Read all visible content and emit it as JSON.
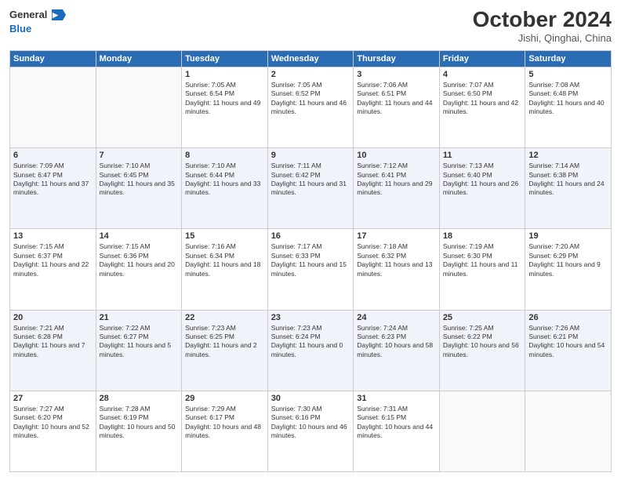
{
  "header": {
    "logo_line1": "General",
    "logo_line2": "Blue",
    "month": "October 2024",
    "location": "Jishi, Qinghai, China"
  },
  "days_of_week": [
    "Sunday",
    "Monday",
    "Tuesday",
    "Wednesday",
    "Thursday",
    "Friday",
    "Saturday"
  ],
  "weeks": [
    [
      {
        "day": "",
        "empty": true
      },
      {
        "day": "",
        "empty": true
      },
      {
        "day": "1",
        "sunrise": "Sunrise: 7:05 AM",
        "sunset": "Sunset: 6:54 PM",
        "daylight": "Daylight: 11 hours and 49 minutes."
      },
      {
        "day": "2",
        "sunrise": "Sunrise: 7:05 AM",
        "sunset": "Sunset: 6:52 PM",
        "daylight": "Daylight: 11 hours and 46 minutes."
      },
      {
        "day": "3",
        "sunrise": "Sunrise: 7:06 AM",
        "sunset": "Sunset: 6:51 PM",
        "daylight": "Daylight: 11 hours and 44 minutes."
      },
      {
        "day": "4",
        "sunrise": "Sunrise: 7:07 AM",
        "sunset": "Sunset: 6:50 PM",
        "daylight": "Daylight: 11 hours and 42 minutes."
      },
      {
        "day": "5",
        "sunrise": "Sunrise: 7:08 AM",
        "sunset": "Sunset: 6:48 PM",
        "daylight": "Daylight: 11 hours and 40 minutes."
      }
    ],
    [
      {
        "day": "6",
        "sunrise": "Sunrise: 7:09 AM",
        "sunset": "Sunset: 6:47 PM",
        "daylight": "Daylight: 11 hours and 37 minutes."
      },
      {
        "day": "7",
        "sunrise": "Sunrise: 7:10 AM",
        "sunset": "Sunset: 6:45 PM",
        "daylight": "Daylight: 11 hours and 35 minutes."
      },
      {
        "day": "8",
        "sunrise": "Sunrise: 7:10 AM",
        "sunset": "Sunset: 6:44 PM",
        "daylight": "Daylight: 11 hours and 33 minutes."
      },
      {
        "day": "9",
        "sunrise": "Sunrise: 7:11 AM",
        "sunset": "Sunset: 6:42 PM",
        "daylight": "Daylight: 11 hours and 31 minutes."
      },
      {
        "day": "10",
        "sunrise": "Sunrise: 7:12 AM",
        "sunset": "Sunset: 6:41 PM",
        "daylight": "Daylight: 11 hours and 29 minutes."
      },
      {
        "day": "11",
        "sunrise": "Sunrise: 7:13 AM",
        "sunset": "Sunset: 6:40 PM",
        "daylight": "Daylight: 11 hours and 26 minutes."
      },
      {
        "day": "12",
        "sunrise": "Sunrise: 7:14 AM",
        "sunset": "Sunset: 6:38 PM",
        "daylight": "Daylight: 11 hours and 24 minutes."
      }
    ],
    [
      {
        "day": "13",
        "sunrise": "Sunrise: 7:15 AM",
        "sunset": "Sunset: 6:37 PM",
        "daylight": "Daylight: 11 hours and 22 minutes."
      },
      {
        "day": "14",
        "sunrise": "Sunrise: 7:15 AM",
        "sunset": "Sunset: 6:36 PM",
        "daylight": "Daylight: 11 hours and 20 minutes."
      },
      {
        "day": "15",
        "sunrise": "Sunrise: 7:16 AM",
        "sunset": "Sunset: 6:34 PM",
        "daylight": "Daylight: 11 hours and 18 minutes."
      },
      {
        "day": "16",
        "sunrise": "Sunrise: 7:17 AM",
        "sunset": "Sunset: 6:33 PM",
        "daylight": "Daylight: 11 hours and 15 minutes."
      },
      {
        "day": "17",
        "sunrise": "Sunrise: 7:18 AM",
        "sunset": "Sunset: 6:32 PM",
        "daylight": "Daylight: 11 hours and 13 minutes."
      },
      {
        "day": "18",
        "sunrise": "Sunrise: 7:19 AM",
        "sunset": "Sunset: 6:30 PM",
        "daylight": "Daylight: 11 hours and 11 minutes."
      },
      {
        "day": "19",
        "sunrise": "Sunrise: 7:20 AM",
        "sunset": "Sunset: 6:29 PM",
        "daylight": "Daylight: 11 hours and 9 minutes."
      }
    ],
    [
      {
        "day": "20",
        "sunrise": "Sunrise: 7:21 AM",
        "sunset": "Sunset: 6:28 PM",
        "daylight": "Daylight: 11 hours and 7 minutes."
      },
      {
        "day": "21",
        "sunrise": "Sunrise: 7:22 AM",
        "sunset": "Sunset: 6:27 PM",
        "daylight": "Daylight: 11 hours and 5 minutes."
      },
      {
        "day": "22",
        "sunrise": "Sunrise: 7:23 AM",
        "sunset": "Sunset: 6:25 PM",
        "daylight": "Daylight: 11 hours and 2 minutes."
      },
      {
        "day": "23",
        "sunrise": "Sunrise: 7:23 AM",
        "sunset": "Sunset: 6:24 PM",
        "daylight": "Daylight: 11 hours and 0 minutes."
      },
      {
        "day": "24",
        "sunrise": "Sunrise: 7:24 AM",
        "sunset": "Sunset: 6:23 PM",
        "daylight": "Daylight: 10 hours and 58 minutes."
      },
      {
        "day": "25",
        "sunrise": "Sunrise: 7:25 AM",
        "sunset": "Sunset: 6:22 PM",
        "daylight": "Daylight: 10 hours and 56 minutes."
      },
      {
        "day": "26",
        "sunrise": "Sunrise: 7:26 AM",
        "sunset": "Sunset: 6:21 PM",
        "daylight": "Daylight: 10 hours and 54 minutes."
      }
    ],
    [
      {
        "day": "27",
        "sunrise": "Sunrise: 7:27 AM",
        "sunset": "Sunset: 6:20 PM",
        "daylight": "Daylight: 10 hours and 52 minutes."
      },
      {
        "day": "28",
        "sunrise": "Sunrise: 7:28 AM",
        "sunset": "Sunset: 6:19 PM",
        "daylight": "Daylight: 10 hours and 50 minutes."
      },
      {
        "day": "29",
        "sunrise": "Sunrise: 7:29 AM",
        "sunset": "Sunset: 6:17 PM",
        "daylight": "Daylight: 10 hours and 48 minutes."
      },
      {
        "day": "30",
        "sunrise": "Sunrise: 7:30 AM",
        "sunset": "Sunset: 6:16 PM",
        "daylight": "Daylight: 10 hours and 46 minutes."
      },
      {
        "day": "31",
        "sunrise": "Sunrise: 7:31 AM",
        "sunset": "Sunset: 6:15 PM",
        "daylight": "Daylight: 10 hours and 44 minutes."
      },
      {
        "day": "",
        "empty": true
      },
      {
        "day": "",
        "empty": true
      }
    ]
  ]
}
